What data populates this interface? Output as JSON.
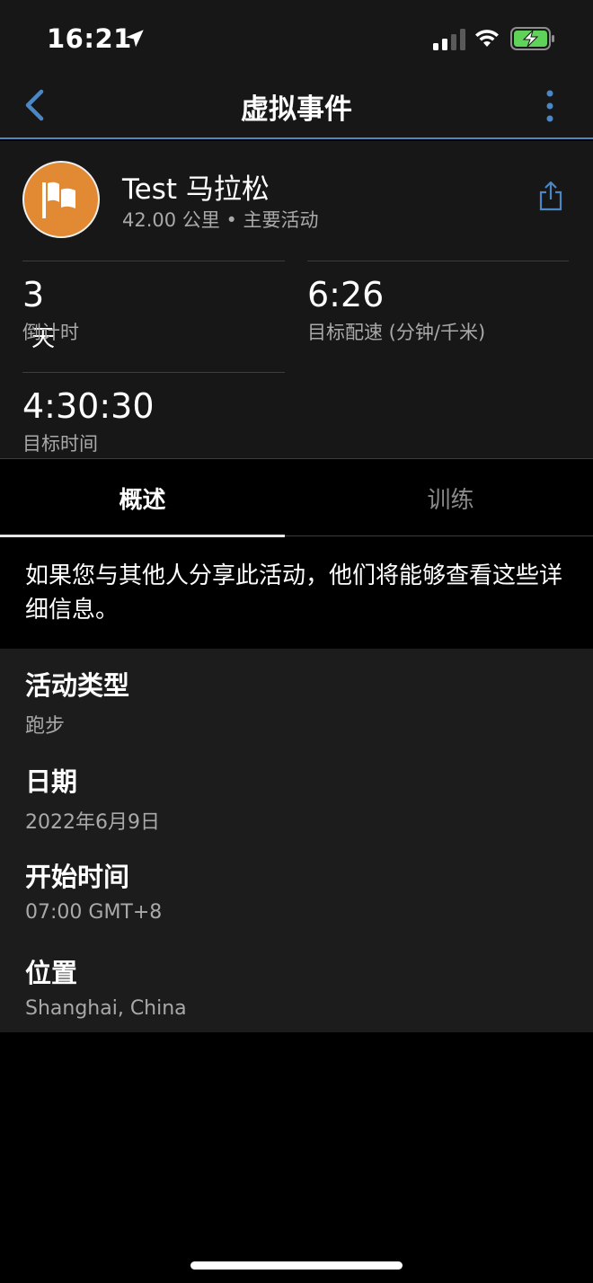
{
  "status_bar": {
    "time": "16:21"
  },
  "nav": {
    "title": "虚拟事件",
    "accent_color": "#4b87c4"
  },
  "event": {
    "name": "Test 马拉松",
    "subtitle": "42.00 公里 • 主要活动",
    "avatar_color": "#e28a33",
    "stats": {
      "countdown": {
        "value": "3",
        "unit": "天",
        "label": "倒计时"
      },
      "pace": {
        "value": "6:26",
        "label": "目标配速 (分钟/千米)"
      },
      "goal_time": {
        "value": "4:30:30",
        "label": "目标时间"
      }
    }
  },
  "tabs": [
    {
      "label": "概述",
      "active": true
    },
    {
      "label": "训练",
      "active": false
    }
  ],
  "notice": "如果您与其他人分享此活动，他们将能够查看这些详细信息。",
  "details": [
    {
      "label": "活动类型",
      "value": "跑步"
    },
    {
      "label": "日期",
      "value": "2022年6月9日"
    },
    {
      "label": "开始时间",
      "value": "07:00 GMT+8"
    },
    {
      "label": "位置",
      "value": "Shanghai, China"
    }
  ]
}
